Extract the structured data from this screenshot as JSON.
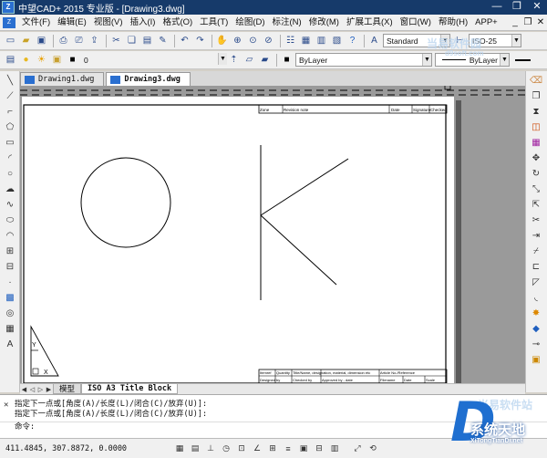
{
  "window": {
    "title": "中望CAD+ 2015 专业版 - [Drawing3.dwg]",
    "minimize": "—",
    "restore": "❐",
    "close": "✕"
  },
  "menubar": {
    "items": [
      "文件(F)",
      "编辑(E)",
      "视图(V)",
      "插入(I)",
      "格式(O)",
      "工具(T)",
      "绘图(D)",
      "标注(N)",
      "修改(M)",
      "扩展工具(X)",
      "窗口(W)",
      "帮助(H)",
      "APP+"
    ],
    "right_controls": [
      "_",
      "❐",
      "✕"
    ]
  },
  "toolbar1": {
    "text_style": "Standard",
    "dim_style": "ISO-25"
  },
  "toolbar2": {
    "layer": "0",
    "color": "ByLayer",
    "linetype": "ByLayer"
  },
  "doc_tabs": [
    {
      "label": "Drawing1.dwg",
      "active": false
    },
    {
      "label": "Drawing3.dwg",
      "active": true
    }
  ],
  "title_block": {
    "header": [
      "Zone",
      "Revision note",
      "Date",
      "Signature",
      "Checked"
    ],
    "footer_head": [
      "Itemref",
      "Quantity",
      "Title/Name, designation, material, dimension etc",
      "Article No./Reference"
    ],
    "footer_row": [
      "Designed by",
      "Checked by",
      "Approved by - date",
      "Filename",
      "Date",
      "Scale"
    ]
  },
  "layout_tabs": {
    "model": "模型",
    "layout": "ISO A3 Title Block"
  },
  "command": {
    "lines": [
      "指定下一点或[角度(A)/长度(L)/闭合(C)/放弃(U)]:",
      "指定下一点或[角度(A)/长度(L)/闭合(C)/放弃(U)]:"
    ],
    "prompt": "命令:"
  },
  "status": {
    "coordinates": "411.4845, 307.8872, 0.0000"
  },
  "watermark": {
    "brand": "系统天地",
    "url": "XiTongTianDi.net",
    "faint_top": "当易软件园",
    "faint_bottom": "当易软件站",
    "url_top": "d9soft.com"
  }
}
